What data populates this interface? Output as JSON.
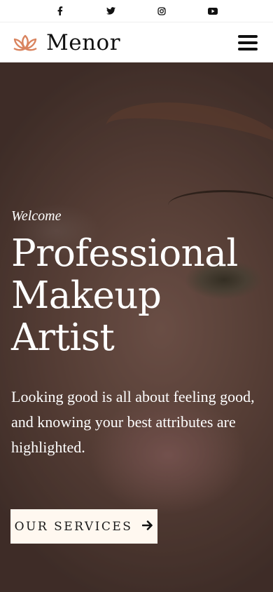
{
  "topbar": {
    "social": [
      {
        "name": "facebook-icon",
        "glyph": "f"
      },
      {
        "name": "twitter-icon",
        "glyph": "🐦"
      },
      {
        "name": "instagram-icon",
        "glyph": "◎"
      },
      {
        "name": "youtube-icon",
        "glyph": "▶"
      }
    ]
  },
  "header": {
    "brand": "Menor",
    "menu_icon": "hamburger-icon",
    "logo_color": "#d9845f"
  },
  "hero": {
    "welcome": "Welcome",
    "headline_lines": [
      "Professional",
      "Makeup",
      "Artist"
    ],
    "lead": "Looking good is all about feeling good, and knowing your best attributes are highlighted.",
    "cta_label": "OUR SERVICES",
    "cta_icon": "arrow-right-icon"
  }
}
